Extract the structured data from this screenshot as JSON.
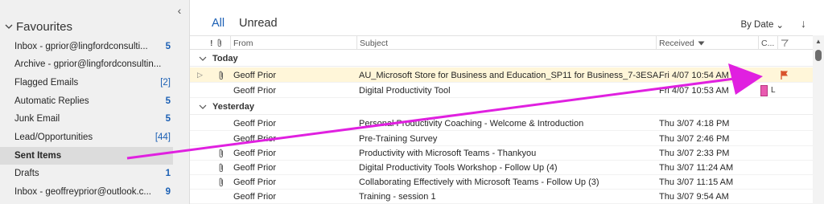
{
  "sidebar": {
    "collapse_glyph": "‹",
    "favourites_label": "Favourites",
    "items": [
      {
        "label": "Inbox - gprior@lingfordconsulti...",
        "count": "5"
      },
      {
        "label": "Archive - gprior@lingfordconsultin...",
        "count": ""
      },
      {
        "label": "Flagged Emails",
        "count": "[2]"
      },
      {
        "label": "Automatic Replies",
        "count": "5"
      },
      {
        "label": "Junk Email",
        "count": "5"
      },
      {
        "label": "Lead/Opportunities",
        "count": "[44]"
      },
      {
        "label": "Sent Items",
        "count": "",
        "selected": true
      },
      {
        "label": "Drafts",
        "count": "1"
      },
      {
        "label": "Inbox - geoffreyprior@outlook.c...",
        "count": "9"
      }
    ]
  },
  "mail_list": {
    "tabs": {
      "all": "All",
      "unread": "Unread"
    },
    "sort_by": "By Date",
    "sort_chevron": "⌄",
    "sort_direction": "↓",
    "columns": {
      "icons": "!",
      "from": "From",
      "subject": "Subject",
      "received": "Received",
      "categories": "C..."
    },
    "groups": [
      {
        "label": "Today",
        "rows": [
          {
            "from": "Geoff Prior",
            "subject": "AU_Microsoft Store for Business and Education_SP11 for Business_7-3ESA...",
            "received": "Fri 4/07 10:54 AM",
            "attachment": true,
            "expandable": true,
            "flag": true,
            "highlight": true
          },
          {
            "from": "Geoff Prior",
            "subject": "Digital Productivity Tool",
            "received": "Fri 4/07 10:53 AM",
            "attachment": false,
            "category": "L",
            "category_color": "#e85ab0"
          }
        ]
      },
      {
        "label": "Yesterday",
        "rows": [
          {
            "from": "Geoff Prior",
            "subject": "Personal Productivity Coaching - Welcome & Introduction",
            "received": "Thu 3/07 4:18 PM",
            "attachment": false
          },
          {
            "from": "Geoff Prior",
            "subject": "Pre-Training Survey",
            "received": "Thu 3/07 2:46 PM",
            "attachment": false
          },
          {
            "from": "Geoff Prior",
            "subject": "Productivity with Microsoft Teams - Thankyou",
            "received": "Thu 3/07 2:33 PM",
            "attachment": true
          },
          {
            "from": "Geoff Prior",
            "subject": "Digital Productivity Tools Workshop - Follow Up (4)",
            "received": "Thu 3/07 11:24 AM",
            "attachment": true
          },
          {
            "from": "Geoff Prior",
            "subject": "Collaborating Effectively with Microsoft Teams - Follow Up (3)",
            "received": "Thu 3/07 11:15 AM",
            "attachment": true
          },
          {
            "from": "Geoff Prior",
            "subject": "Training - session 1",
            "received": "Thu 3/07 9:54 AM",
            "attachment": false
          }
        ]
      }
    ]
  },
  "colors": {
    "accent": "#1a5fb4",
    "annotation_arrow": "#e020e0",
    "flag": "#d9532c",
    "highlight_row": "#fff6d9"
  }
}
